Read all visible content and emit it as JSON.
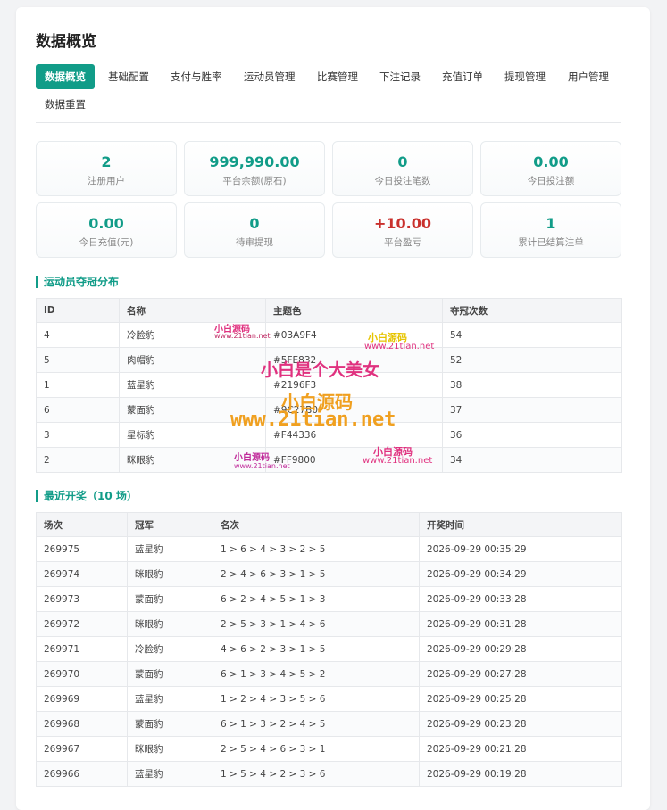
{
  "page": {
    "title": "数据概览"
  },
  "tabs": [
    {
      "label": "数据概览",
      "active": true
    },
    {
      "label": "基础配置"
    },
    {
      "label": "支付与胜率"
    },
    {
      "label": "运动员管理"
    },
    {
      "label": "比赛管理"
    },
    {
      "label": "下注记录"
    },
    {
      "label": "充值订单"
    },
    {
      "label": "提现管理"
    },
    {
      "label": "用户管理"
    },
    {
      "label": "数据重置"
    }
  ],
  "stats": [
    {
      "value": "2",
      "label": "注册用户"
    },
    {
      "value": "999,990.00",
      "label": "平台余额(原石)"
    },
    {
      "value": "0",
      "label": "今日投注笔数"
    },
    {
      "value": "0.00",
      "label": "今日投注额"
    },
    {
      "value": "0.00",
      "label": "今日充值(元)"
    },
    {
      "value": "0",
      "label": "待审提现"
    },
    {
      "value": "+10.00",
      "label": "平台盈亏",
      "color": "#c9302c"
    },
    {
      "value": "1",
      "label": "累计已结算注单"
    }
  ],
  "champions": {
    "title": "运动员夺冠分布",
    "headers": [
      "ID",
      "名称",
      "主题色",
      "夺冠次数"
    ],
    "rows": [
      [
        "4",
        "冷脸豹",
        "#03A9F4",
        "54"
      ],
      [
        "5",
        "肉帽豹",
        "#5FE832",
        "52"
      ],
      [
        "1",
        "蓝星豹",
        "#2196F3",
        "38"
      ],
      [
        "6",
        "蒙面豹",
        "#9C27B0",
        "37"
      ],
      [
        "3",
        "星标豹",
        "#F44336",
        "36"
      ],
      [
        "2",
        "眯眼豹",
        "#FF9800",
        "34"
      ]
    ]
  },
  "recent": {
    "title": "最近开奖（10 场）",
    "headers": [
      "场次",
      "冠军",
      "名次",
      "开奖时间"
    ],
    "rows": [
      [
        "269975",
        "蓝星豹",
        "1 > 6 > 4 > 3 > 2 > 5",
        "2026-09-29 00:35:29"
      ],
      [
        "269974",
        "眯眼豹",
        "2 > 4 > 6 > 3 > 1 > 5",
        "2026-09-29 00:34:29"
      ],
      [
        "269973",
        "蒙面豹",
        "6 > 2 > 4 > 5 > 1 > 3",
        "2026-09-29 00:33:28"
      ],
      [
        "269972",
        "眯眼豹",
        "2 > 5 > 3 > 1 > 4 > 6",
        "2026-09-29 00:31:28"
      ],
      [
        "269971",
        "冷脸豹",
        "4 > 6 > 2 > 3 > 1 > 5",
        "2026-09-29 00:29:28"
      ],
      [
        "269970",
        "蒙面豹",
        "6 > 1 > 3 > 4 > 5 > 2",
        "2026-09-29 00:27:28"
      ],
      [
        "269969",
        "蓝星豹",
        "1 > 2 > 4 > 3 > 5 > 6",
        "2026-09-29 00:25:28"
      ],
      [
        "269968",
        "蒙面豹",
        "6 > 1 > 3 > 2 > 4 > 5",
        "2026-09-29 00:23:28"
      ],
      [
        "269967",
        "眯眼豹",
        "2 > 5 > 4 > 6 > 3 > 1",
        "2026-09-29 00:21:28"
      ],
      [
        "269966",
        "蓝星豹",
        "1 > 5 > 4 > 2 > 3 > 6",
        "2026-09-29 00:19:28"
      ]
    ]
  },
  "watermark": {
    "a": "小白源码",
    "b": "www.21tian.net",
    "c": "小白源码",
    "d": "www.21tian.net",
    "e": "小白是个大美女",
    "f": "小白源码",
    "g": "www.21tian.net",
    "h": "小白源码",
    "i": "www.21tian.net",
    "j": "小白源码",
    "k": "www.21tian.net"
  }
}
